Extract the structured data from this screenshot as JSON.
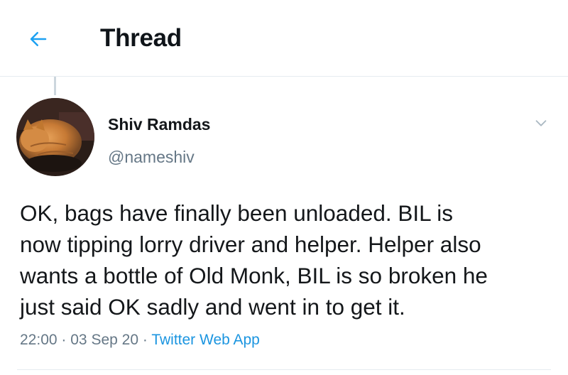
{
  "header": {
    "title": "Thread"
  },
  "tweet": {
    "author_name": "Shiv Ramdas",
    "author_handle": "@nameshiv",
    "text": "OK, bags have finally been unloaded. BIL is\nnow tipping lorry driver and helper. Helper also\nwants a bottle of Old Monk, BIL is so broken he\njust said OK sadly and went in to get it.",
    "time": "22:00",
    "date": "03 Sep 20",
    "source": "Twitter Web App",
    "separator": "·"
  },
  "icons": {
    "back": "back-arrow-icon",
    "more": "chevron-down-icon",
    "avatar": "cat-avatar"
  },
  "colors": {
    "accent": "#1da1f2",
    "link": "#1b95e0",
    "secondary_text": "#657786"
  }
}
